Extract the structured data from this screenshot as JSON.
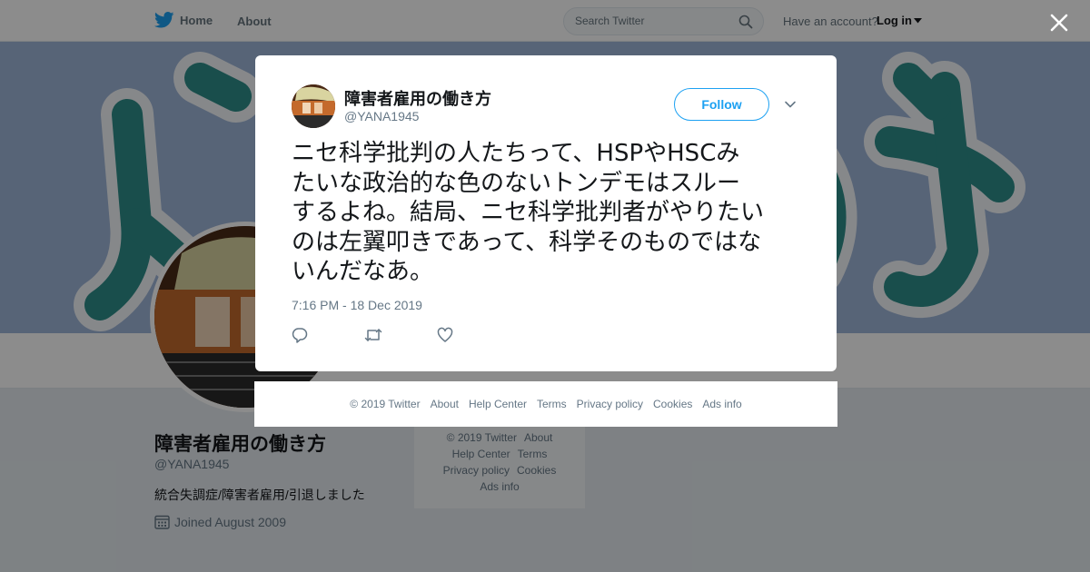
{
  "topbar": {
    "home_label": "Home",
    "about_label": "About",
    "search_placeholder": "Search Twitter",
    "account_question": "Have an account?",
    "login_label": "Log in"
  },
  "profile": {
    "name": "障害者雇用の働き方",
    "handle": "@YANA1945",
    "bio": "統合失調症/障害者雇用/引退しました",
    "joined": "Joined August 2009"
  },
  "side_footer": {
    "row1": [
      "© 2019 Twitter",
      "About"
    ],
    "row2": [
      "Help Center",
      "Terms"
    ],
    "row3": [
      "Privacy policy",
      "Cookies"
    ],
    "row4": [
      "Ads info"
    ]
  },
  "tweet": {
    "author_name": "障害者雇用の働き方",
    "author_handle": "@YANA1945",
    "follow_label": "Follow",
    "lines": [
      "ニセ科学批判の人たちって、HSPやHSCみ",
      "たいな政治的な色のないトンデモはスルー",
      "するよね。結局、ニセ科学批判者がやりたい",
      "のは左翼叩きであって、科学そのものではな",
      "いんだなあ。"
    ],
    "timestamp": "7:16 PM - 18 Dec 2019"
  },
  "modal_footer": [
    "© 2019 Twitter",
    "About",
    "Help Center",
    "Terms",
    "Privacy policy",
    "Cookies",
    "Ads info"
  ],
  "colors": {
    "brand": "#1da1f2",
    "muted": "#657786",
    "text": "#14171a",
    "banner": "#9fb6d9",
    "banner_glyph": "#2e8f8a"
  },
  "icons": [
    "twitter-bird-icon",
    "search-icon",
    "caret-down-icon",
    "close-icon",
    "calendar-icon",
    "reply-icon",
    "retweet-icon",
    "like-icon",
    "chevron-down-icon"
  ]
}
